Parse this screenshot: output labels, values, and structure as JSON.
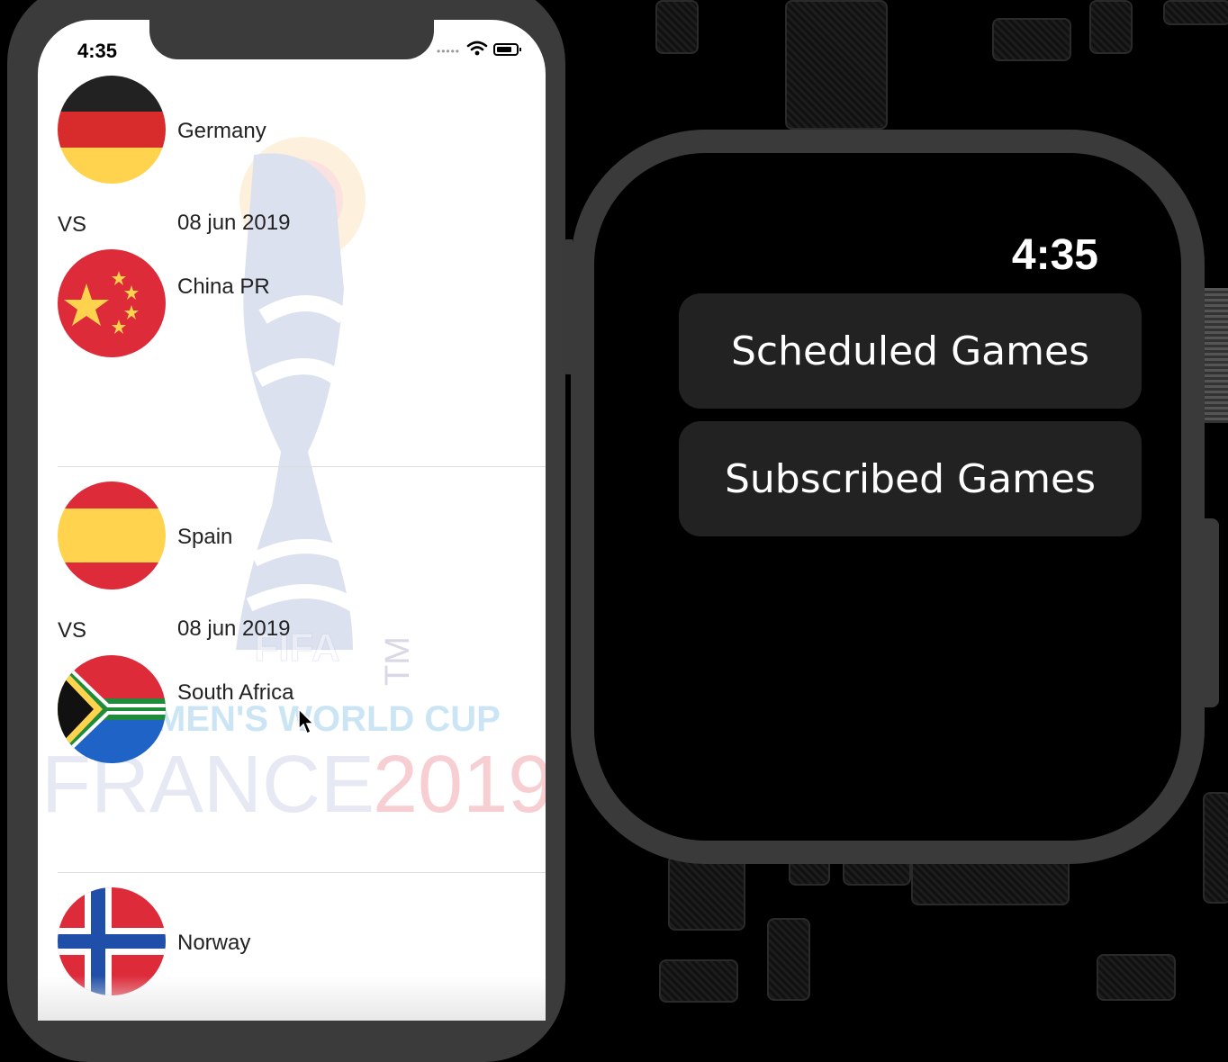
{
  "phone": {
    "status_time": "4:35",
    "matches": [
      {
        "team1": "Germany",
        "vs": "VS",
        "date": "08 jun 2019",
        "team2": "China PR"
      },
      {
        "team1": "Spain",
        "vs": "VS",
        "date": "08 jun 2019",
        "team2": "South Africa"
      },
      {
        "team1": "Norway"
      }
    ],
    "watermark": {
      "brand": "FIFA",
      "tm": "TM",
      "line1": "WOMEN'S WORLD CUP",
      "line2_country": "FRANCE",
      "line2_year": "2019"
    }
  },
  "watch": {
    "time": "4:35",
    "buttons": [
      "Scheduled Games",
      "Subscribed Games"
    ]
  },
  "colors": {
    "phone_frame": "#3b3b3b",
    "watch_frame": "#3a3a3a",
    "watch_button_bg": "#222222"
  }
}
